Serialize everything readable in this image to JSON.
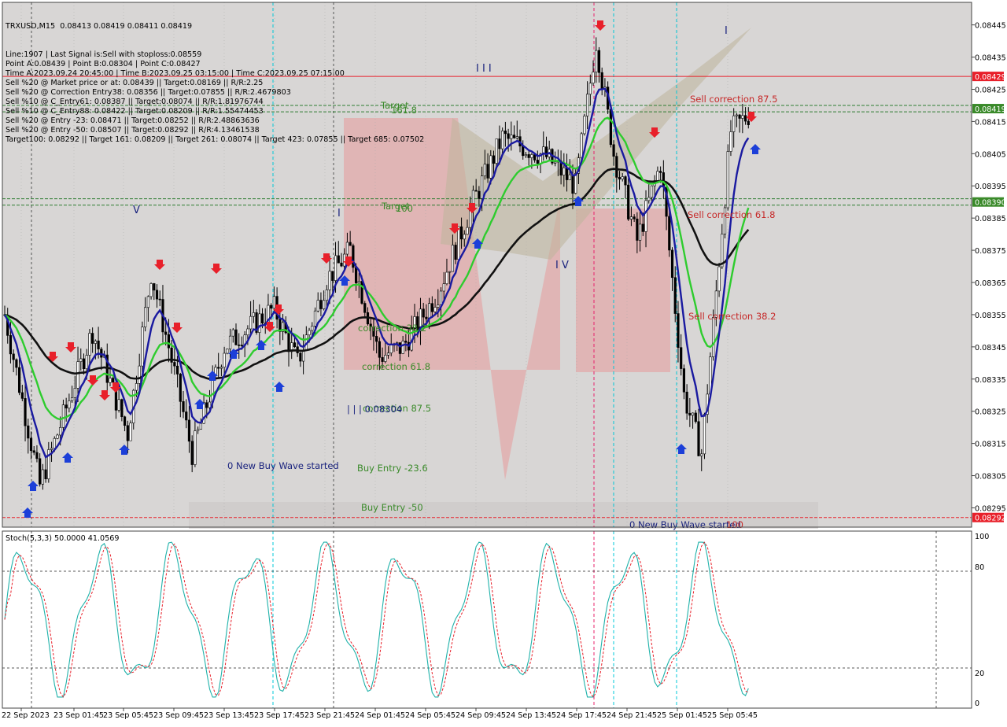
{
  "chart_data": {
    "type": "candlestick",
    "symbol_timeframe": "TRXUSD,M15",
    "ohlc": "0.08413 0.08419 0.08411 0.08419",
    "info_lines": [
      "Line:1907 | Last Signal is:Sell with stoploss:0.08559",
      "Point A:0.08439 | Point B:0.08304 | Point C:0.08427",
      "Time A:2023.09.24 20:45:00 | Time B:2023.09.25 03:15:00 | Time C:2023.09.25 07:15:00",
      "Sell %20 @ Market price or at: 0.08439 || Target:0.08169 || R/R:2.25",
      "Sell %20 @ Correction Entry38: 0.08356 || Target:0.07855 || R/R:2.4679803",
      "Sell %10 @ C_Entry61: 0.08387 || Target:0.08074 || R/R:1.81976744",
      "Sell %10 @ C_Entry88: 0.08422 || Target:0.08209 || R/R:1.55474453",
      "Sell %20 @ Entry -23: 0.08471 || Target:0.08252 || R/R:2.48863636",
      "Sell %20 @ Entry -50: 0.08507 || Target:0.08292 || R/R:4.13461538",
      "Target100: 0.08292 || Target 161: 0.08209 || Target 261: 0.08074 || Target 423: 0.07855 || Target 685: 0.07502"
    ],
    "y_ticks": [
      "0.08445",
      "0.08435",
      "0.08425",
      "0.08415",
      "0.08405",
      "0.08395",
      "0.08385",
      "0.08375",
      "0.08365",
      "0.08355",
      "0.08345",
      "0.08335",
      "0.08325",
      "0.08315",
      "0.08305",
      "0.08295"
    ],
    "y_range": [
      0.08289,
      0.08452
    ],
    "price_labels": [
      {
        "value": "0.08429",
        "price": 0.08429,
        "color": "#e8202a"
      },
      {
        "value": "0.08419",
        "price": 0.08419,
        "color": "#3a8a2a"
      },
      {
        "value": "0.08390",
        "price": 0.0839,
        "color": "#3a8a2a"
      },
      {
        "value": "0.08292",
        "price": 0.08292,
        "color": "#e8202a"
      }
    ],
    "horizontal_lines": [
      {
        "price": 0.08429,
        "color": "#e8202a",
        "dash": ""
      },
      {
        "price": 0.0842,
        "color": "#2e7d32",
        "dash": "4,2"
      },
      {
        "price": 0.08418,
        "color": "#2e7d32",
        "dash": "4,2"
      },
      {
        "price": 0.08391,
        "color": "#2e7d32",
        "dash": "4,2"
      },
      {
        "price": 0.08389,
        "color": "#2e7d32",
        "dash": "4,2"
      },
      {
        "price": 0.08292,
        "color": "#e8202a",
        "dash": "4,2"
      }
    ],
    "x_ticks": [
      "22 Sep 2023",
      "23 Sep 01:45",
      "23 Sep 05:45",
      "23 Sep 09:45",
      "23 Sep 13:45",
      "23 Sep 17:45",
      "23 Sep 21:45",
      "24 Sep 01:45",
      "24 Sep 05:45",
      "24 Sep 09:45",
      "24 Sep 13:45",
      "24 Sep 17:45",
      "24 Sep 21:45",
      "25 Sep 01:45",
      "25 Sep 05:45"
    ],
    "annotations": [
      {
        "text": "Target",
        "price": 0.08417,
        "color": "#3a8a2a"
      },
      {
        "text": "161.8",
        "price": 0.08416,
        "color": "#3a8a2a"
      },
      {
        "text": "Target",
        "price": 0.08387,
        "color": "#3a8a2a"
      },
      {
        "text": "100",
        "price": 0.08386,
        "color": "#3a8a2a"
      },
      {
        "text": "Sell correction 87.5",
        "price": 0.0842,
        "color": "#c62828"
      },
      {
        "text": "Sell correction 61.8",
        "price": 0.08386,
        "color": "#c62828"
      },
      {
        "text": "Sell correction 38.2",
        "price": 0.08356,
        "color": "#c62828"
      },
      {
        "text": "correction 61.8",
        "price": 0.08338,
        "color": "#3a8a2a"
      },
      {
        "text": "correction 38.2",
        "price": 0.08348,
        "color": "#3a8a2a"
      },
      {
        "text": "correction 87.5",
        "price": 0.08326,
        "color": "#3a8a2a"
      },
      {
        "text": "| | | 0.08304",
        "price": 0.08325,
        "color": "#1a237e"
      },
      {
        "text": "0 New Buy Wave started",
        "price": 0.08309,
        "color": "#1a237e"
      },
      {
        "text": "Buy Entry -23.6",
        "price": 0.08308,
        "color": "#3a8a2a"
      },
      {
        "text": "Buy Entry -50",
        "price": 0.08297,
        "color": "#3a8a2a"
      },
      {
        "text": "0 New Buy Wave started",
        "price": 0.0829,
        "color": "#1a237e"
      },
      {
        "text": "100",
        "price": 0.0829,
        "color": "#c62828"
      }
    ],
    "wave_labels": [
      {
        "text": "V",
        "price": 0.08388,
        "color": "#1a237e"
      },
      {
        "text": "I",
        "price": 0.08387,
        "color": "#1a237e"
      },
      {
        "text": "I I I",
        "price": 0.08429,
        "color": "#1a237e"
      },
      {
        "text": "I V",
        "price": 0.08371,
        "color": "#1a237e"
      },
      {
        "text": "I",
        "price": 0.08446,
        "color": "#1a237e"
      }
    ],
    "stochastic": {
      "label": "Stoch(5,3,3) 50.0000 41.0569",
      "levels": [
        "100",
        "80",
        "20",
        "0"
      ],
      "main_color": "#20b2aa",
      "signal_color": "#e8202a"
    },
    "series_colors": {
      "candle": "#000000",
      "ma_fast": "#1a1aa0",
      "ma_mid": "#2ecc2e",
      "ma_slow": "#111111"
    },
    "watermark_color": "#e89a9a"
  }
}
